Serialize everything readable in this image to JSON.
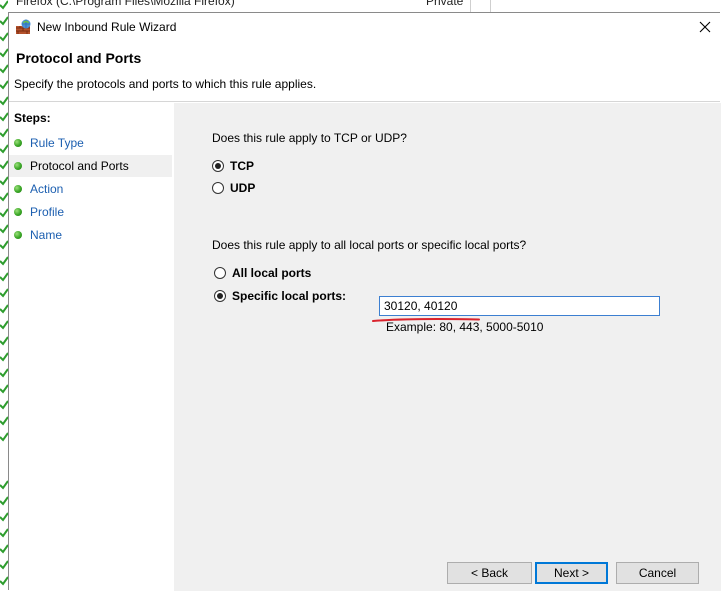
{
  "background": {
    "top_text": "Firefox (C:\\Program Files\\Mozilla Firefox)",
    "top_right_text": "Private"
  },
  "dialog": {
    "title": "New Inbound Rule Wizard",
    "header_title": "Protocol and Ports",
    "header_subtitle": "Specify the protocols and ports to which this rule applies."
  },
  "steps": {
    "label": "Steps:",
    "items": [
      {
        "label": "Rule Type"
      },
      {
        "label": "Protocol and Ports"
      },
      {
        "label": "Action"
      },
      {
        "label": "Profile"
      },
      {
        "label": "Name"
      }
    ],
    "active_index": 1
  },
  "protocol": {
    "question": "Does this rule apply to TCP or UDP?",
    "options": [
      {
        "label": "TCP",
        "selected": true
      },
      {
        "label": "UDP",
        "selected": false
      }
    ]
  },
  "ports": {
    "question": "Does this rule apply to all local ports or specific local ports?",
    "all_label": "All local ports",
    "specific_label": "Specific local ports:",
    "specific_selected": true,
    "value": "30120, 40120",
    "example": "Example: 80, 443, 5000-5010"
  },
  "buttons": {
    "back": "< Back",
    "next": "Next >",
    "cancel": "Cancel"
  },
  "colors": {
    "accent": "#0078d7",
    "link": "#1c5fb0",
    "annotation_red": "#d9232d",
    "step_dot": "#3aa626"
  }
}
